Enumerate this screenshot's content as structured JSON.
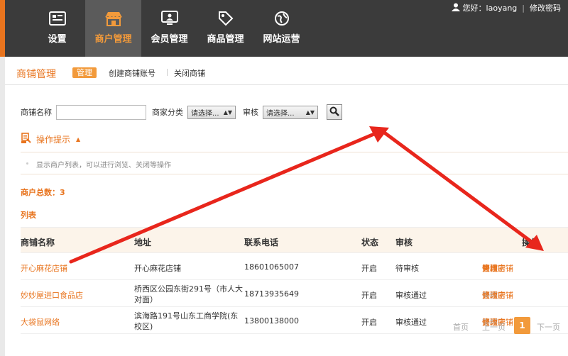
{
  "user": {
    "greeting": "您好：laoyang",
    "change_password": "修改密码"
  },
  "nav": [
    {
      "label": "设置",
      "icon": "settings-icon",
      "active": false
    },
    {
      "label": "商户管理",
      "icon": "store-icon",
      "active": true
    },
    {
      "label": "会员管理",
      "icon": "member-icon",
      "active": false
    },
    {
      "label": "商品管理",
      "icon": "tag-icon",
      "active": false
    },
    {
      "label": "网站运营",
      "icon": "globe-icon",
      "active": false
    }
  ],
  "subheader": {
    "title": "商铺管理",
    "active_tab": "管理",
    "link_create": "创建商铺账号",
    "link_close": "关闭商铺"
  },
  "filter": {
    "name_label": "商铺名称",
    "name_placeholder": "",
    "category_label": "商家分类",
    "category_value": "请选择...",
    "review_label": "审核",
    "review_value": "请选择..."
  },
  "tips": {
    "title": "操作提示",
    "text": "显示商户列表，可以进行浏览、关闭等操作"
  },
  "summary": {
    "count_text": "商户总数：3",
    "list_title": "列表"
  },
  "table": {
    "headers": [
      "商铺名称",
      "地址",
      "联系电话",
      "状态",
      "审核",
      "操作"
    ],
    "rows": [
      {
        "name": "开心麻花店铺",
        "address": "开心麻花店铺",
        "address2": "",
        "phone": "18601065007",
        "status": "开启",
        "review": "待审核",
        "ops": [
          "管理店铺",
          "关闭",
          "审核",
          "修改密"
        ],
        "review_disabled": false
      },
      {
        "name": "妙妙屋进口食品店",
        "address": "桥西区公园东街291号（市人大",
        "address2": "对面）",
        "phone": "18713935649",
        "status": "开启",
        "review": "审核通过",
        "ops": [
          "管理店铺",
          "关闭",
          "审核",
          "修改密"
        ],
        "review_disabled": true
      },
      {
        "name": "大袋鼠网络",
        "address": "滨海路191号山东工商学院(东",
        "address2": "校区)",
        "phone": "13800138000",
        "status": "开启",
        "review": "审核通过",
        "ops": [
          "管理店铺",
          "关闭",
          "审核",
          "修改密"
        ],
        "review_disabled": true
      }
    ]
  },
  "pager": {
    "first": "首页",
    "prev": "上一页",
    "current": "1",
    "next": "下一页"
  },
  "colors": {
    "accent": "#e8741e",
    "nav_bg": "#3b3b3b",
    "arrow": "#e8261c"
  }
}
